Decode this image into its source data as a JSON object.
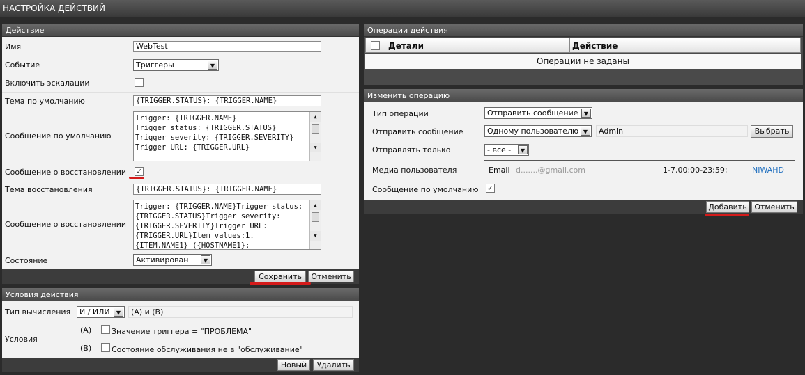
{
  "window_title": "НАСТРОЙКА ДЕЙСТВИЙ",
  "action": {
    "title": "Действие",
    "name_label": "Имя",
    "name_value": "WebTest",
    "event_label": "Событие",
    "event_value": "Триггеры",
    "escalation_label": "Включить эскалации",
    "def_subject_label": "Тема по умолчанию",
    "def_subject_value": "{TRIGGER.STATUS}: {TRIGGER.NAME}",
    "def_message_label": "Сообщение по умолчанию",
    "def_message_value": "Trigger: {TRIGGER.NAME}\nTrigger status: {TRIGGER.STATUS}\nTrigger severity: {TRIGGER.SEVERITY}\nTrigger URL: {TRIGGER.URL}",
    "recovery_msg_check_label": "Сообщение о восстановлении",
    "recovery_subject_label": "Тема восстановления",
    "recovery_subject_value": "{TRIGGER.STATUS}: {TRIGGER.NAME}",
    "recovery_message_label": "Сообщение о восстановлении",
    "recovery_message_value": "Trigger: {TRIGGER.NAME}Trigger status:\n{TRIGGER.STATUS}Trigger severity:\n{TRIGGER.SEVERITY}Trigger URL:\n{TRIGGER.URL}Item values:1.\n{ITEM.NAME1} ({HOSTNAME1}:",
    "status_label": "Состояние",
    "status_value": "Активирован",
    "save_label": "Сохранить",
    "cancel_label": "Отменить"
  },
  "conditions": {
    "title": "Условия действия",
    "calc_label": "Тип вычисления",
    "calc_value": "И / ИЛИ",
    "calc_formula": "(A) и (B)",
    "conditions_label": "Условия",
    "items": [
      {
        "tag": "(A)",
        "text": "Значение триггера = \"ПРОБЛЕМА\""
      },
      {
        "tag": "(B)",
        "text": "Состояние обслуживания не в \"обслуживание\""
      }
    ],
    "new_label": "Новый",
    "delete_label": "Удалить"
  },
  "operations": {
    "title": "Операции действия",
    "col_details": "Детали",
    "col_action": "Действие",
    "empty_text": "Операции не заданы"
  },
  "edit_op": {
    "title": "Изменить операцию",
    "op_type_label": "Тип операции",
    "op_type_value": "Отправить сообщение",
    "send_to_label": "Отправить сообщение",
    "send_to_value": "Одному пользователю",
    "user_value": "Admin",
    "choose_label": "Выбрать",
    "send_only_label": "Отправлять только",
    "send_only_value": "- все -",
    "media_label": "Медиа пользователя",
    "media_type": "Email",
    "media_address": "d.......@gmail.com",
    "media_period": "1-7,00:00-23:59;",
    "media_severity": "NIWAHD",
    "default_msg_label": "Сообщение по умолчанию",
    "add_label": "Добавить",
    "cancel_label": "Отменить"
  },
  "colors": {
    "accent_underline": "#d41a1a",
    "severity_link": "#1f6fbf"
  }
}
